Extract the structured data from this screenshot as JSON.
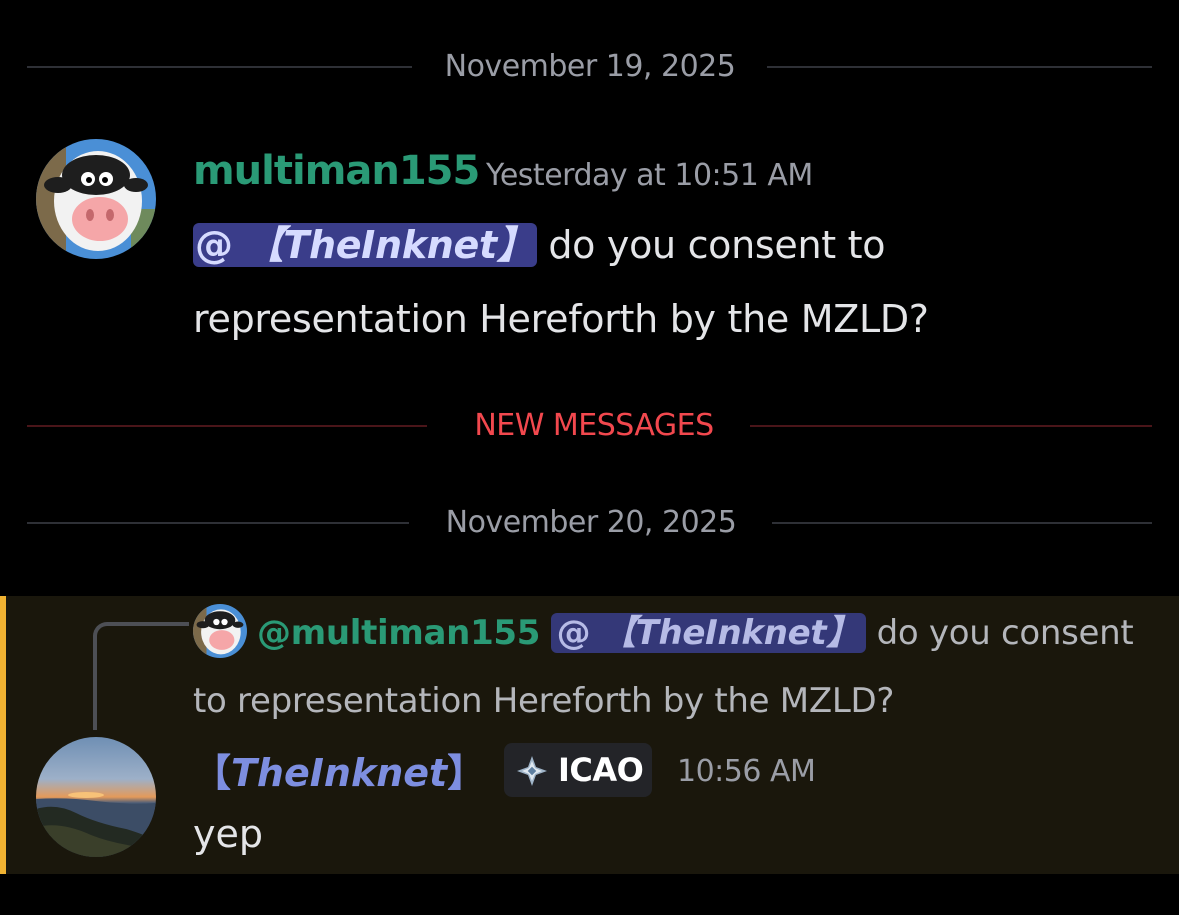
{
  "dividers": {
    "date1": "November 19, 2025",
    "new_messages": "NEW MESSAGES",
    "date2": "November 20, 2025"
  },
  "message1": {
    "username": "multiman155",
    "timestamp": "Yesterday at 10:51 AM",
    "mention_at": "@",
    "mention_name": "【TheInknet】",
    "text_line1": " do you consent to",
    "text_line2": "representation Hereforth by the MZLD?",
    "avatar": "cow-avatar"
  },
  "message2": {
    "reply": {
      "username": "@multiman155",
      "mention_at": "@",
      "mention_name": "【TheInknet】",
      "text": " do you consent to representation Hereforth by the MZLD?",
      "avatar": "cow-avatar"
    },
    "bracket_open": "【",
    "username_core": "TheInknet",
    "bracket_close": "】",
    "tag_label": "ICAO",
    "tag_icon": "diamond-compass-icon",
    "timestamp": "10:56 AM",
    "text": "yep",
    "avatar": "sunset-coast-avatar"
  },
  "colors": {
    "username_green": "#2a9a76",
    "mention_bg": "#3a3d8a",
    "new_messages_red": "#f2484e",
    "highlight_bar": "#f0b232",
    "role_blue": "#7d8ee0"
  }
}
